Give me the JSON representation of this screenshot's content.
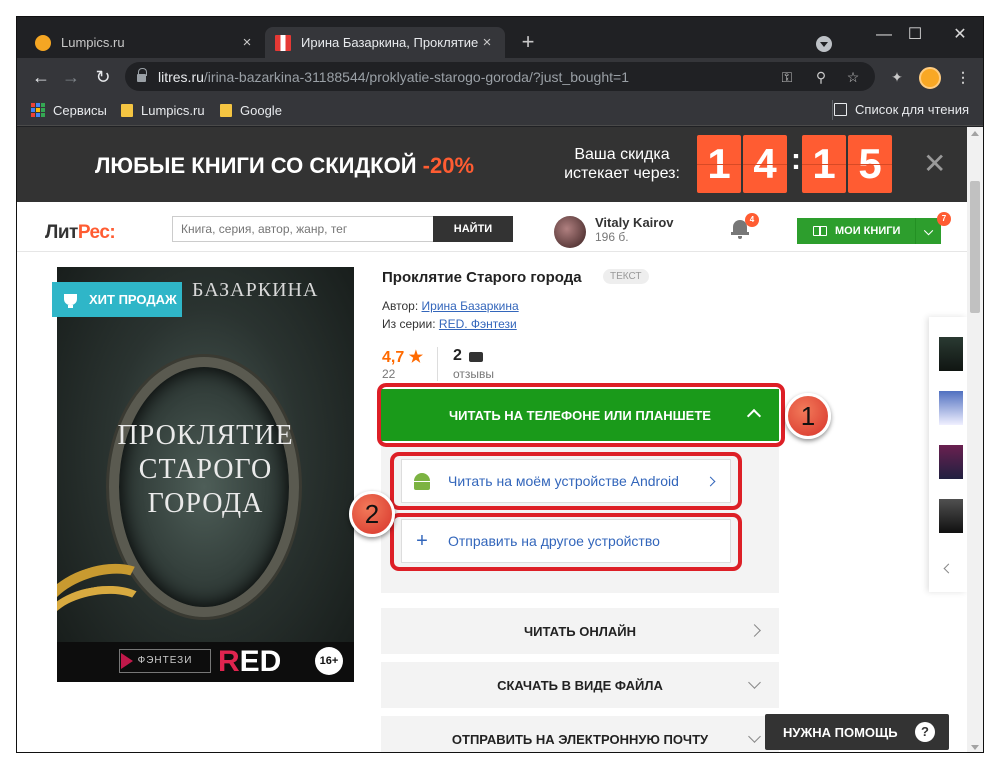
{
  "browser": {
    "tabs": [
      {
        "title": "Lumpics.ru",
        "close": "×"
      },
      {
        "title": "Ирина Базаркина, Проклятие С",
        "close": "×"
      }
    ],
    "new_tab": "+",
    "window_controls": {
      "minimize": "—",
      "maximize": "☐",
      "close": "✕"
    },
    "url": {
      "host": "litres.ru",
      "path": "/irina-bazarkina-31188544/proklyatie-starogo-goroda/?just_bought=1"
    },
    "bookmarks": [
      {
        "label": "Сервисы",
        "icon": "apps-grid-icon"
      },
      {
        "label": "Lumpics.ru",
        "icon": "folder-icon"
      },
      {
        "label": "Google",
        "icon": "folder-icon"
      }
    ],
    "reading_list": "Список для чтения"
  },
  "promo": {
    "text": "ЛЮБЫЕ КНИГИ СО СКИДКОЙ",
    "percent": "-20%",
    "timer_label": "Ваша скидка истекает через:",
    "digits": [
      "1",
      "4",
      "1",
      "5"
    ],
    "separator": ":",
    "close": "✕"
  },
  "header": {
    "logo_left": "Лит",
    "logo_right": "Рес:",
    "search_placeholder": "Книга, серия, автор, жанр, тег",
    "search_button": "НАЙТИ",
    "user_name": "Vitaly Kairov",
    "user_points": "196 б.",
    "notifications_count": "4",
    "my_books": "МОИ КНИГИ",
    "my_books_count": "7",
    "my_books_dropdown": "⌵"
  },
  "book": {
    "badge": "ХИТ ПРОДАЖ",
    "cover": {
      "author": "БАЗАРКИНА",
      "title_lines": [
        "ПРОКЛЯТИЕ",
        "СТАРОГО",
        "ГОРОДА"
      ],
      "genre": "ФЭНТЕЗИ",
      "series_logo_r": "R",
      "series_logo_rest": "ED",
      "age": "16+"
    },
    "title": "Проклятие Старого города",
    "type": "ТЕКСТ",
    "author_label": "Автор:",
    "author": "Ирина Базаркина",
    "series_label": "Из серии:",
    "series": "RED. Фэнтези",
    "rating": "4,7",
    "rating_star": "★",
    "rating_count": "22",
    "reviews": "2",
    "reviews_label": "отзывы"
  },
  "actions": {
    "read_on_phone": "ЧИТАТЬ НА ТЕЛЕФОНЕ ИЛИ ПЛАНШЕТЕ",
    "read_android": "Читать на моём устройстве Android",
    "send_device": "Отправить на другое устройство",
    "read_online": "ЧИТАТЬ ОНЛАЙН",
    "download_file": "СКАЧАТЬ В ВИДЕ ФАЙЛА",
    "send_email": "ОТПРАВИТЬ НА ЭЛЕКТРОННУЮ ПОЧТУ"
  },
  "callouts": [
    "1",
    "2"
  ],
  "help": {
    "label": "НУЖНА ПОМОЩЬ",
    "icon": "?"
  }
}
